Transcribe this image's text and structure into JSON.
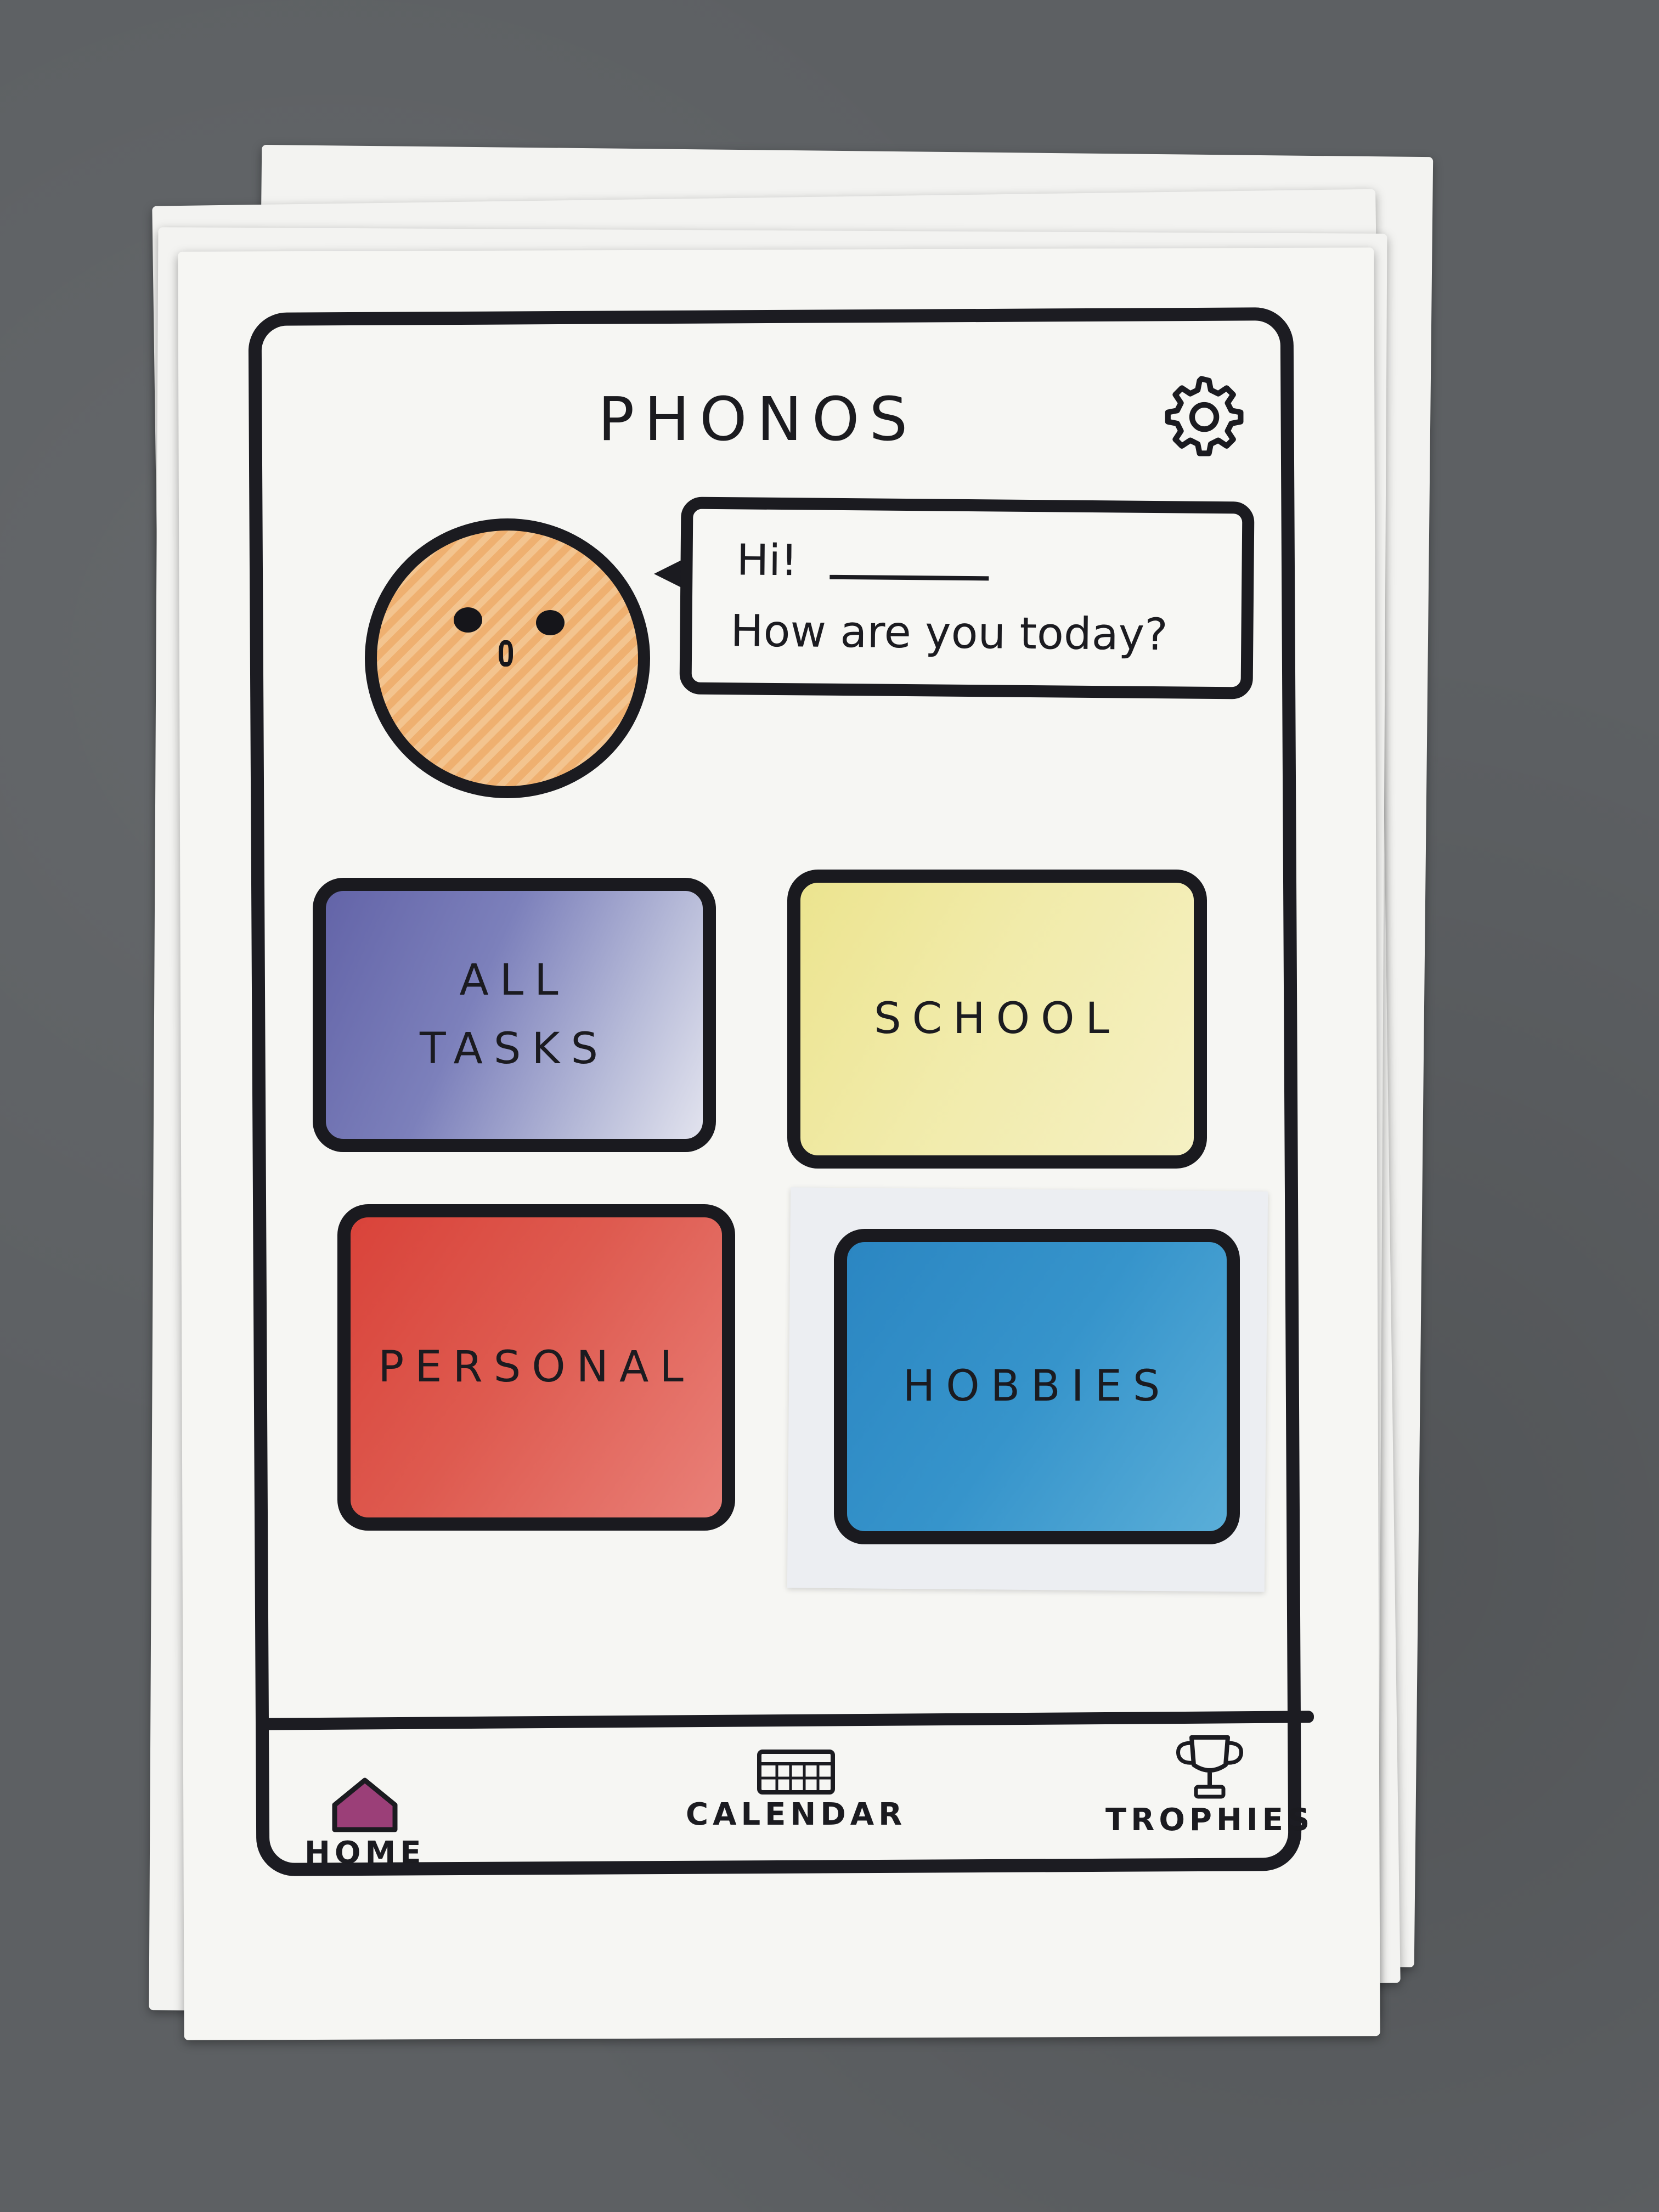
{
  "app": {
    "title": "PHONOS"
  },
  "chat": {
    "greeting": "Hi!",
    "question": "How are you today?"
  },
  "categories": [
    {
      "label": "ALL\nTASKS",
      "color": "#6f72b1"
    },
    {
      "label": "SCHOOL",
      "color": "#efe79d"
    },
    {
      "label": "PERSONAL",
      "color": "#d9453c"
    },
    {
      "label": "HOBBIES",
      "color": "#2f8cc5"
    }
  ],
  "nav": {
    "home": "HOME",
    "calendar": "CALENDAR",
    "trophies": "TROPHIES",
    "active": "home"
  },
  "icons": {
    "settings": "gear-icon",
    "home": "home-icon",
    "calendar": "calendar-icon",
    "trophies": "trophy-icon"
  },
  "colors": {
    "outline": "#1b1b20",
    "avatar": "#efb070",
    "home_icon_fill": "#9b3f78"
  }
}
